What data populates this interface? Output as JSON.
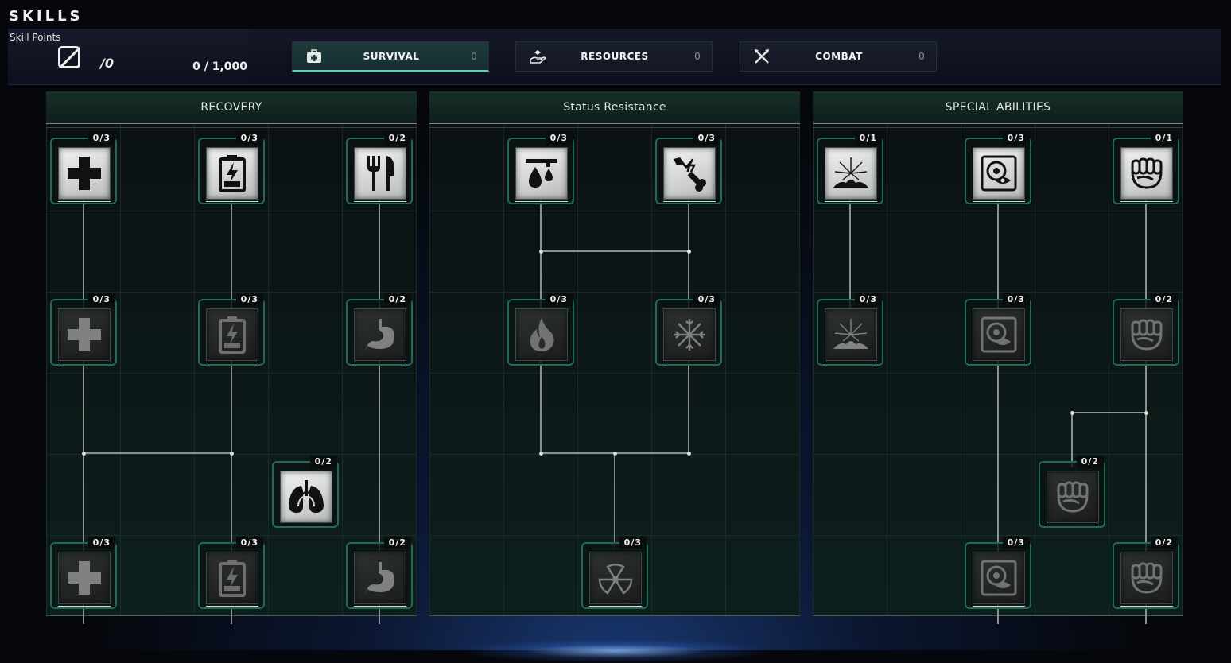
{
  "header": {
    "title": "SKILLS",
    "skill_points_label": "Skill Points",
    "skill_points_fraction": "/0",
    "skill_points_count": "0 / 1,000"
  },
  "tabs": [
    {
      "label": "SURVIVAL",
      "count": "0",
      "icon": "medkit-icon",
      "active": true
    },
    {
      "label": "RESOURCES",
      "count": "0",
      "icon": "resource-hand-icon",
      "active": false
    },
    {
      "label": "COMBAT",
      "count": "0",
      "icon": "crossed-weapons-icon",
      "active": false
    }
  ],
  "panels": [
    {
      "title": "RECOVERY",
      "skills": [
        {
          "level": "0/3",
          "icon": "medical-cross-icon",
          "state": "unlocked"
        },
        {
          "level": "0/3",
          "icon": "battery-icon",
          "state": "unlocked"
        },
        {
          "level": "0/2",
          "icon": "fork-knife-icon",
          "state": "unlocked"
        },
        {
          "level": "0/3",
          "icon": "medical-cross-icon",
          "state": "locked"
        },
        {
          "level": "0/3",
          "icon": "battery-icon",
          "state": "locked"
        },
        {
          "level": "0/2",
          "icon": "stomach-icon",
          "state": "locked"
        },
        {
          "level": "0/2",
          "icon": "lungs-icon",
          "state": "unlocked"
        },
        {
          "level": "0/3",
          "icon": "medical-cross-icon",
          "state": "locked"
        },
        {
          "level": "0/3",
          "icon": "battery-icon",
          "state": "locked"
        },
        {
          "level": "0/2",
          "icon": "stomach-icon",
          "state": "locked"
        }
      ]
    },
    {
      "title": "Status Resistance",
      "skills": [
        {
          "level": "0/3",
          "icon": "drip-icon",
          "state": "unlocked"
        },
        {
          "level": "0/3",
          "icon": "broken-bone-icon",
          "state": "unlocked"
        },
        {
          "level": "0/3",
          "icon": "flame-icon",
          "state": "locked"
        },
        {
          "level": "0/3",
          "icon": "snowflake-icon",
          "state": "locked"
        },
        {
          "level": "0/3",
          "icon": "radiation-icon",
          "state": "locked"
        }
      ]
    },
    {
      "title": "SPECIAL ABILITIES",
      "skills": [
        {
          "level": "0/1",
          "icon": "impact-burst-icon",
          "state": "unlocked"
        },
        {
          "level": "0/3",
          "icon": "eye-scanner-icon",
          "state": "unlocked"
        },
        {
          "level": "0/1",
          "icon": "fist-icon",
          "state": "unlocked"
        },
        {
          "level": "0/3",
          "icon": "impact-burst-icon",
          "state": "locked"
        },
        {
          "level": "0/3",
          "icon": "eye-scanner-icon",
          "state": "locked"
        },
        {
          "level": "0/2",
          "icon": "fist-icon",
          "state": "locked"
        },
        {
          "level": "0/2",
          "icon": "fist-icon",
          "state": "locked"
        },
        {
          "level": "0/3",
          "icon": "eye-scanner-icon",
          "state": "locked"
        },
        {
          "level": "0/2",
          "icon": "fist-icon",
          "state": "locked"
        }
      ]
    }
  ]
}
